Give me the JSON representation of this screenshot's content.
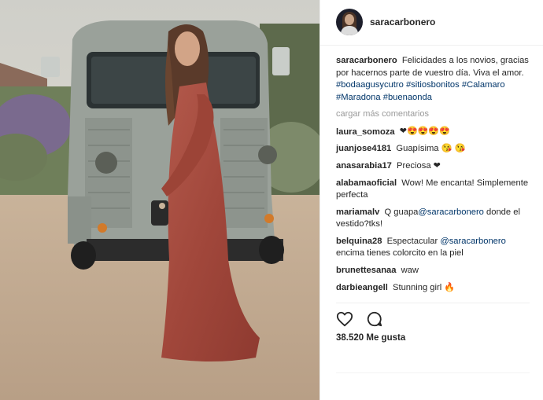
{
  "post": {
    "username": "saracarbonero",
    "caption": {
      "username": "saracarbonero",
      "text": "Felicidades a los novios, gracias por hacernos parte de vuestro día. Viva el amor.",
      "hashtags": [
        "#bodaagusycutro",
        "#sitiosbonitos",
        "#Calamaro",
        "#Maradona",
        "#buenaonda"
      ]
    },
    "load_more": "cargar más comentarios",
    "comments": [
      {
        "user": "laura_somoza",
        "text": "❤😍😍😍😍"
      },
      {
        "user": "juanjose4181",
        "text": "Guapísima 😘 😘"
      },
      {
        "user": "anasarabia17",
        "text": "Preciosa ❤"
      },
      {
        "user": "alabamaoficial",
        "text": "Wow! Me encanta! Simplemente perfecta"
      },
      {
        "user": "mariamalv",
        "text_before": "Q guapa",
        "mention": "@saracarbonero",
        "text_after": "donde el vestido?tks!"
      },
      {
        "user": "belquina28",
        "text_before": "Espectacular",
        "mention": "@saracarbonero",
        "text_after": "encima tienes colorcito en la piel"
      },
      {
        "user": "brunettesanaa",
        "text": "waw"
      },
      {
        "user": "darbieangell",
        "text": "Stunning girl 🔥"
      }
    ],
    "likes": "38.520 Me gusta",
    "icons": {
      "like": "heart-icon",
      "comment": "comment-icon"
    },
    "colors": {
      "hashtag": "#003569",
      "muted": "#999999",
      "text": "#262626"
    }
  }
}
